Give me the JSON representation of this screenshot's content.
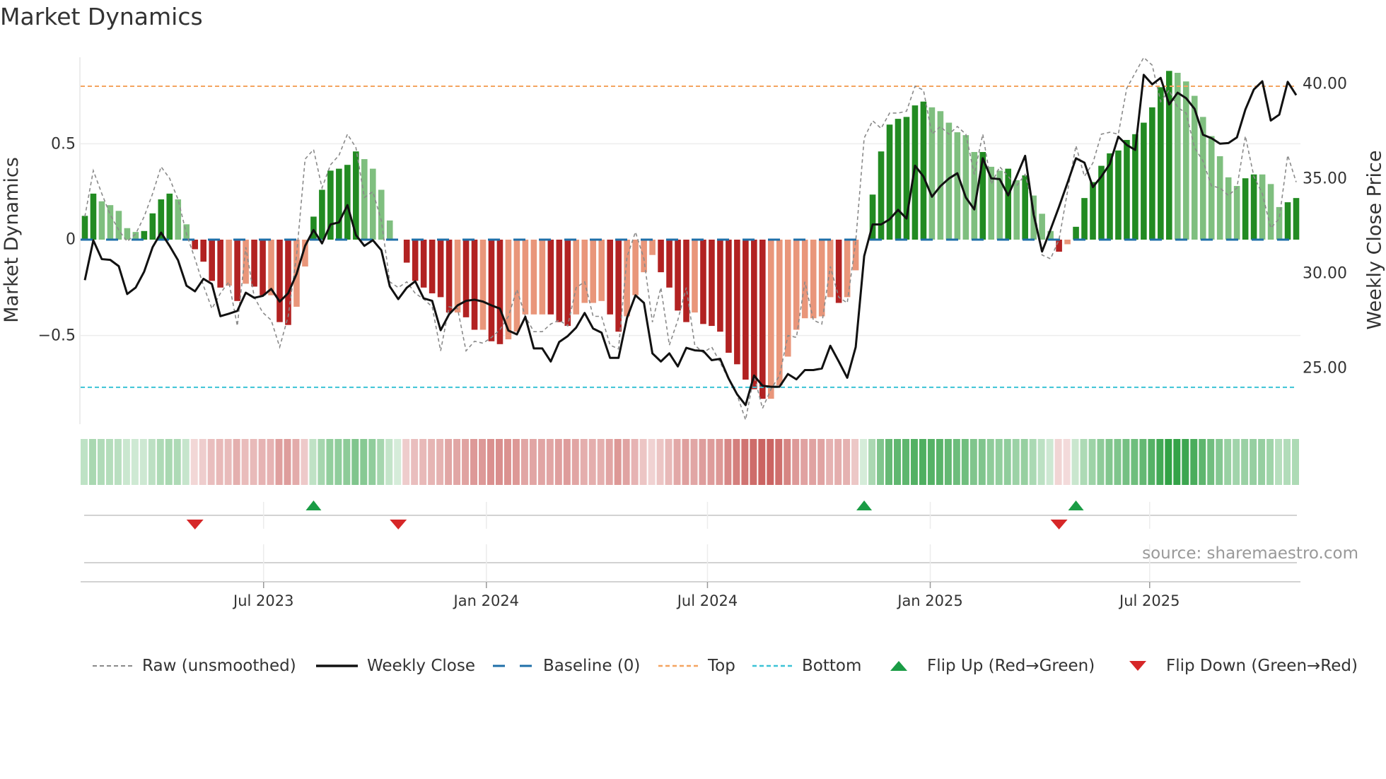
{
  "title": "Market Dynamics",
  "source_note": "source: sharemaestro.com",
  "chart_data": {
    "type": "bar+line",
    "title": "Market Dynamics",
    "ylabel_left": "Market Dynamics",
    "ylabel_right": "Weekly Close Price",
    "left_axis": {
      "ticks": [
        0.5,
        0,
        -0.5
      ],
      "tick_labels": [
        "0.5",
        "0",
        "−0.5"
      ],
      "range": [
        -0.96,
        0.96
      ]
    },
    "right_axis": {
      "ticks": [
        40,
        35,
        30,
        25
      ],
      "tick_labels": [
        "40.00",
        "35.00",
        "30.00",
        "25.00"
      ],
      "range": [
        22.1,
        41.4
      ]
    },
    "x_axis": {
      "unit": "week index",
      "ticks": [
        21.1,
        47.4,
        73.5,
        99.8,
        125.7
      ],
      "tick_labels": [
        "Jul 2023",
        "Jan 2024",
        "Jul 2024",
        "Jan 2025",
        "Jul 2025"
      ]
    },
    "top_level": 0.8,
    "bottom_level": -0.77,
    "baseline": 0,
    "colors": {
      "up_strong": "#228b22",
      "up_weak": "#7fbf7f",
      "down_strong": "#b22222",
      "down_weak": "#e9967a",
      "baseline": "#1f6fa8",
      "top": "#f4a460",
      "bottom": "#3cc3d6",
      "raw": "#8a8a8a",
      "close": "#111111",
      "flip_up": "#1a9c45",
      "flip_down": "#d62728"
    },
    "md_smoothed": [
      0.124,
      0.24,
      0.2,
      0.18,
      0.15,
      0.06,
      0.04,
      0.045,
      0.137,
      0.21,
      0.24,
      0.21,
      0.08,
      -0.05,
      -0.115,
      -0.215,
      -0.25,
      -0.24,
      -0.32,
      -0.23,
      -0.245,
      -0.29,
      -0.29,
      -0.43,
      -0.445,
      -0.35,
      -0.14,
      0.12,
      0.26,
      0.36,
      0.37,
      0.39,
      0.46,
      0.42,
      0.37,
      0.26,
      0.1,
      0,
      -0.12,
      -0.215,
      -0.25,
      -0.28,
      -0.3,
      -0.38,
      -0.38,
      -0.405,
      -0.47,
      -0.47,
      -0.53,
      -0.545,
      -0.52,
      -0.48,
      -0.39,
      -0.39,
      -0.39,
      -0.39,
      -0.43,
      -0.45,
      -0.39,
      -0.33,
      -0.33,
      -0.32,
      -0.39,
      -0.48,
      -0.4,
      -0.29,
      -0.17,
      -0.08,
      -0.17,
      -0.25,
      -0.37,
      -0.43,
      -0.38,
      -0.44,
      -0.45,
      -0.48,
      -0.59,
      -0.65,
      -0.73,
      -0.78,
      -0.83,
      -0.83,
      -0.76,
      -0.61,
      -0.47,
      -0.41,
      -0.41,
      -0.4,
      -0.3,
      -0.33,
      -0.3,
      -0.16,
      0,
      0.235,
      0.46,
      0.6,
      0.63,
      0.64,
      0.7,
      0.72,
      0.69,
      0.67,
      0.61,
      0.56,
      0.545,
      0.457,
      0.457,
      0.38,
      0.36,
      0.37,
      0.31,
      0.335,
      0.23,
      0.135,
      0.045,
      -0.063,
      -0.024,
      0.067,
      0.217,
      0.3,
      0.385,
      0.45,
      0.465,
      0.52,
      0.55,
      0.61,
      0.69,
      0.795,
      0.88,
      0.87,
      0.825,
      0.75,
      0.64,
      0.54,
      0.435,
      0.325,
      0.28,
      0.32,
      0.34,
      0.34,
      0.29,
      0.17,
      0.195,
      0.217
    ],
    "bar_strength": "DDLLLLLDDDDLLDDDDLDLDDLDDLLDDDDDDLLLLLDDDDDDLDDLDDLLLLLDDDLLLLDDLLLLDDDDLDDDDDDDDLLLLLLLLDLLLDDDDDDDLLLLLLDLLDLDLLLDLDDDDDDDDDDDDLLLLLLLLDDLLLDD",
    "md_raw": [
      0.12,
      0.36,
      0.24,
      0.13,
      0.05,
      -0.01,
      0.03,
      0.12,
      0.24,
      0.38,
      0.32,
      0.21,
      0.03,
      -0.1,
      -0.24,
      -0.36,
      -0.28,
      -0.22,
      -0.45,
      -0.04,
      -0.3,
      -0.38,
      -0.42,
      -0.56,
      -0.4,
      -0.08,
      0.42,
      0.47,
      0.27,
      0.39,
      0.44,
      0.55,
      0.48,
      0.22,
      0.25,
      0.1,
      -0.22,
      -0.25,
      -0.22,
      -0.28,
      -0.31,
      -0.35,
      -0.58,
      -0.35,
      -0.36,
      -0.58,
      -0.53,
      -0.54,
      -0.51,
      -0.47,
      -0.4,
      -0.26,
      -0.4,
      -0.48,
      -0.48,
      -0.44,
      -0.42,
      -0.45,
      -0.25,
      -0.22,
      -0.4,
      -0.4,
      -0.55,
      -0.57,
      -0.09,
      0.04,
      -0.1,
      -0.43,
      -0.25,
      -0.55,
      -0.42,
      -0.25,
      -0.55,
      -0.59,
      -0.56,
      -0.64,
      -0.73,
      -0.81,
      -0.94,
      -0.71,
      -0.88,
      -0.78,
      -0.71,
      -0.5,
      -0.51,
      -0.22,
      -0.42,
      -0.44,
      -0.14,
      -0.3,
      -0.33,
      -0.01,
      0.53,
      0.62,
      0.58,
      0.66,
      0.66,
      0.67,
      0.8,
      0.78,
      0.55,
      0.59,
      0.55,
      0.59,
      0.55,
      0.34,
      0.55,
      0.29,
      0.38,
      0.33,
      0.28,
      0.34,
      0.17,
      -0.08,
      -0.1,
      0.0,
      0.25,
      0.49,
      0.33,
      0.4,
      0.55,
      0.56,
      0.55,
      0.79,
      0.87,
      0.95,
      0.91,
      0.72,
      0.78,
      0.69,
      0.66,
      0.48,
      0.41,
      0.28,
      0.27,
      0.23,
      0.27,
      0.54,
      0.33,
      0.24,
      0.06,
      0.11,
      0.44,
      0.3
    ],
    "weekly_close": [
      29.65,
      31.75,
      30.76,
      30.72,
      30.39,
      28.92,
      29.26,
      30.1,
      31.39,
      32.16,
      31.46,
      30.7,
      29.36,
      29.06,
      29.72,
      29.45,
      27.75,
      27.88,
      28.03,
      28.99,
      28.72,
      28.82,
      29.19,
      28.52,
      28.96,
      29.99,
      31.46,
      32.3,
      31.59,
      32.59,
      32.7,
      33.61,
      32.03,
      31.46,
      31.76,
      31.23,
      29.32,
      28.65,
      29.25,
      29.59,
      28.69,
      28.56,
      27.01,
      27.85,
      28.32,
      28.56,
      28.62,
      28.52,
      28.32,
      28.15,
      26.99,
      26.79,
      27.72,
      26.05,
      26.05,
      25.36,
      26.39,
      26.7,
      27.15,
      27.92,
      27.1,
      26.88,
      25.55,
      25.55,
      27.66,
      28.85,
      28.45,
      25.79,
      25.36,
      25.79,
      25.1,
      26.08,
      25.95,
      25.92,
      25.43,
      25.5,
      24.46,
      23.63,
      23.06,
      24.62,
      24.08,
      24.03,
      24.03,
      24.7,
      24.42,
      24.91,
      24.91,
      24.99,
      26.19,
      25.36,
      24.5,
      26.12,
      30.92,
      32.59,
      32.59,
      32.86,
      33.36,
      32.9,
      35.69,
      35.12,
      34.05,
      34.61,
      35.01,
      35.29,
      34.01,
      33.38,
      36.08,
      35.02,
      34.98,
      34.12,
      35.14,
      36.21,
      33.12,
      31.16,
      32.32,
      33.52,
      34.78,
      36.08,
      35.85,
      34.56,
      35.12,
      35.78,
      37.22,
      36.78,
      36.52,
      40.48,
      39.98,
      40.32,
      38.92,
      39.54,
      39.25,
      38.69,
      37.32,
      37.14,
      36.85,
      36.88,
      37.18,
      38.65,
      39.71,
      40.14,
      38.07,
      38.38,
      40.11,
      39.41
    ],
    "flips": [
      {
        "type": "down",
        "week": 13
      },
      {
        "type": "up",
        "week": 27
      },
      {
        "type": "down",
        "week": 37
      },
      {
        "type": "up",
        "week": 92
      },
      {
        "type": "down",
        "week": 115
      },
      {
        "type": "up",
        "week": 117
      }
    ],
    "legend": {
      "placement": "bottom",
      "items": [
        {
          "label": "Raw (unsmoothed)",
          "kind": "raw"
        },
        {
          "label": "Weekly Close",
          "kind": "close"
        },
        {
          "label": "Baseline (0)",
          "kind": "baseline"
        },
        {
          "label": "Top",
          "kind": "top"
        },
        {
          "label": "Bottom",
          "kind": "bottom"
        },
        {
          "label": "Flip Up (Red→Green)",
          "kind": "flip_up"
        },
        {
          "label": "Flip Down (Green→Red)",
          "kind": "flip_down"
        }
      ]
    }
  }
}
